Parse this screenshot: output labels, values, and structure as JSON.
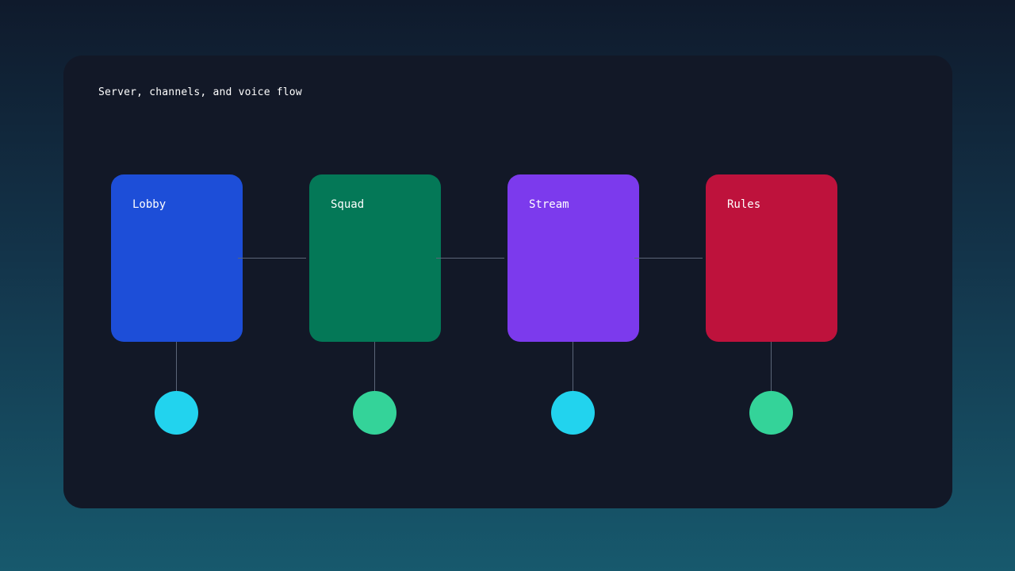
{
  "title": "Server, channels, and voice flow",
  "channels": [
    {
      "label": "Lobby",
      "color": "#1d4ed8",
      "node_color": "#22d3ee"
    },
    {
      "label": "Squad",
      "color": "#047857",
      "node_color": "#34d399"
    },
    {
      "label": "Stream",
      "color": "#7c3aed",
      "node_color": "#22d3ee"
    },
    {
      "label": "Rules",
      "color": "#be123c",
      "node_color": "#34d399"
    }
  ]
}
